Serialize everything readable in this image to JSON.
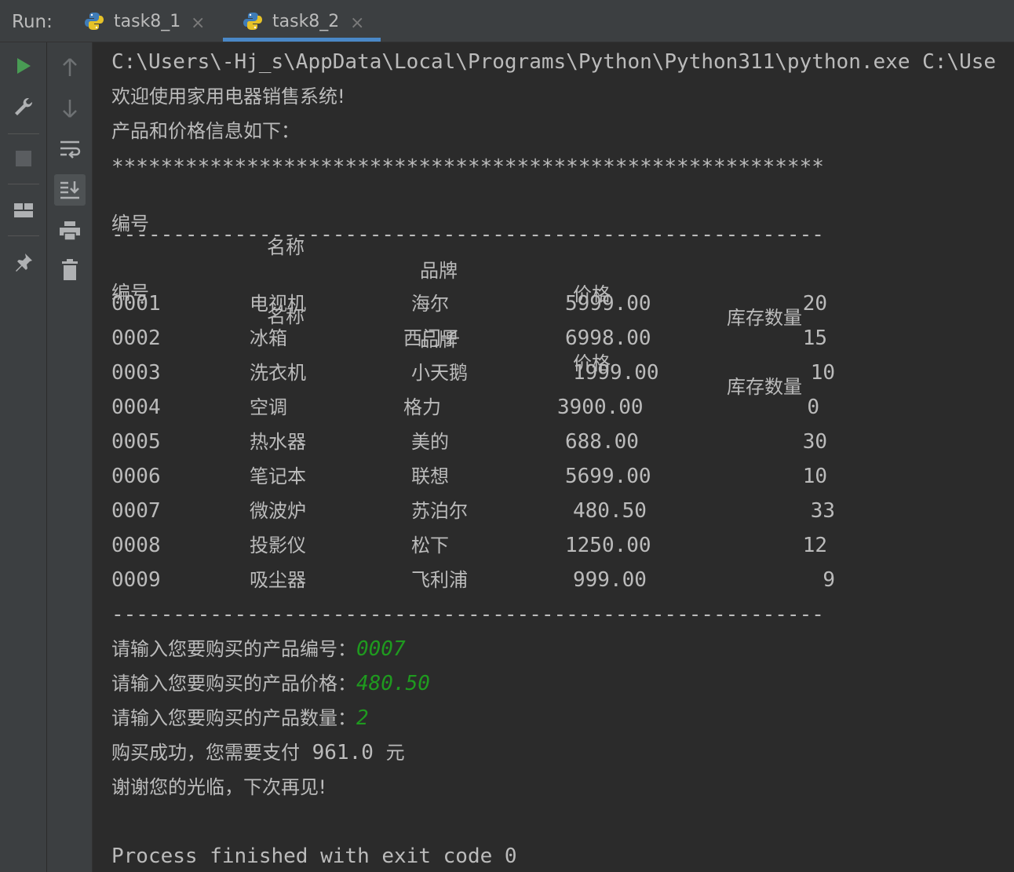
{
  "run_panel": {
    "label": "Run:",
    "tabs": [
      {
        "label": "task8_1",
        "active": false
      },
      {
        "label": "task8_2",
        "active": true
      }
    ]
  },
  "toolbar": {
    "left": [
      "rerun-icon",
      "settings-wrench-icon",
      "stop-icon",
      "layout-icon",
      "pin-icon"
    ],
    "right": [
      "scroll-up-icon",
      "scroll-down-icon",
      "soft-wrap-icon",
      "scroll-to-end-icon",
      "print-icon",
      "clear-trash-icon"
    ]
  },
  "console": {
    "command": "C:\\Users\\-Hj_s\\AppData\\Local\\Programs\\Python\\Python311\\python.exe C:\\Use",
    "welcome": "欢迎使用家用电器销售系统!",
    "info_title": "产品和价格信息如下：",
    "stars": "**********************************************************",
    "header": [
      "编号",
      "名称",
      "品牌",
      "价格",
      "库存数量"
    ],
    "dashes": "----------------------------------------------------------",
    "rows": [
      [
        "0001",
        "电视机",
        "海尔",
        "5999.00",
        "20"
      ],
      [
        "0002",
        "冰箱",
        "西门子",
        "6998.00",
        "15"
      ],
      [
        "0003",
        "洗衣机",
        "小天鹅",
        "1999.00",
        "10"
      ],
      [
        "0004",
        "空调",
        "格力",
        "3900.00",
        "0"
      ],
      [
        "0005",
        "热水器",
        "美的",
        "688.00",
        "30"
      ],
      [
        "0006",
        "笔记本",
        "联想",
        "5699.00",
        "10"
      ],
      [
        "0007",
        "微波炉",
        "苏泊尔",
        "480.50",
        "33"
      ],
      [
        "0008",
        "投影仪",
        "松下",
        "1250.00",
        "12"
      ],
      [
        "0009",
        "吸尘器",
        "飞利浦",
        "999.00",
        "9"
      ]
    ],
    "prompts": [
      {
        "text": "请输入您要购买的产品编号：",
        "value": "0007"
      },
      {
        "text": "请输入您要购买的产品价格：",
        "value": "480.50"
      },
      {
        "text": "请输入您要购买的产品数量：",
        "value": "2"
      }
    ],
    "result_prefix": "购买成功，您需要支付",
    "result_amount": " 961.0 ",
    "result_suffix": "元",
    "goodbye": "谢谢您的光临，下次再见!",
    "exit": "Process finished with exit code 0"
  },
  "colors": {
    "background": "#2b2b2b",
    "panel": "#3c3f41",
    "text": "#bbbbbb",
    "input_green": "#1f9a1f",
    "run_green": "#499c54",
    "tab_accent": "#4a88c7"
  }
}
